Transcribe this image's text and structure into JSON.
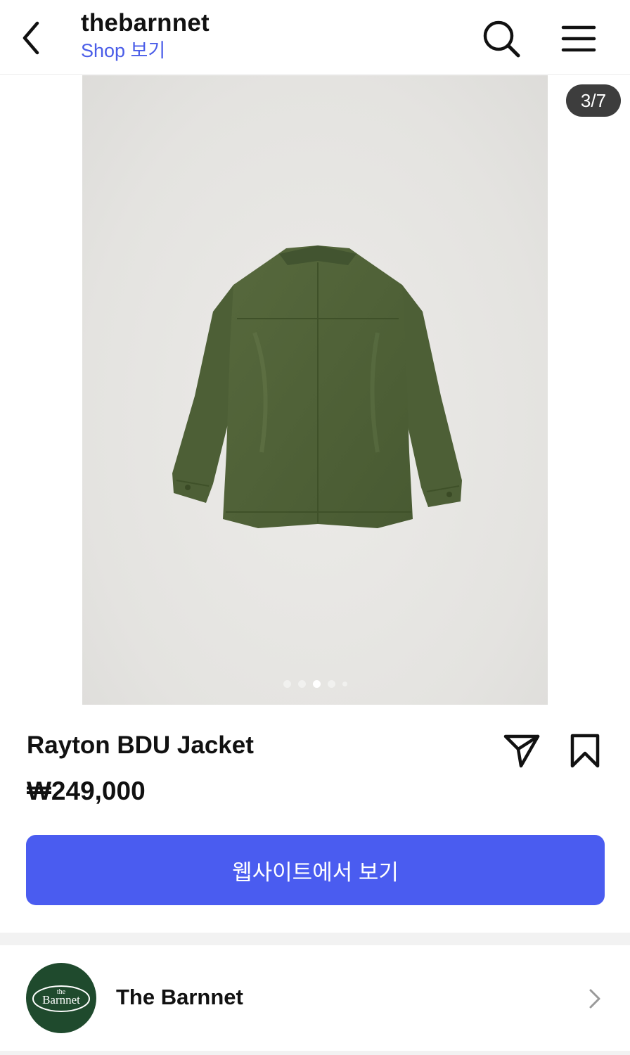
{
  "header": {
    "account_name": "thebarnnet",
    "shop_link": "Shop 보기"
  },
  "carousel": {
    "counter": "3/7",
    "current_index": 3,
    "total": 7
  },
  "product": {
    "name": "Rayton BDU Jacket",
    "price": "₩249,000"
  },
  "cta": {
    "label": "웹사이트에서 보기"
  },
  "shop": {
    "name": "The Barnnet",
    "logo_text_small": "the",
    "logo_text": "Barnnet"
  },
  "colors": {
    "accent": "#4a5cf0",
    "link": "#4a5de8",
    "logo_bg": "#1f4a2d",
    "jacket": "#4f6238"
  }
}
